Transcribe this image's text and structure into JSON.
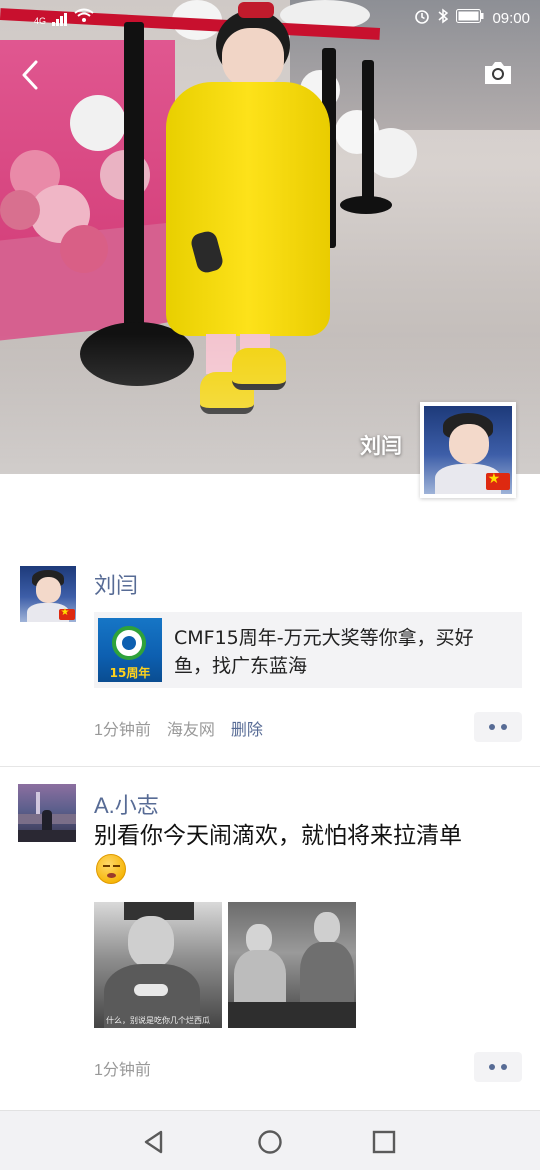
{
  "status_bar": {
    "network": "4G",
    "time": "09:00"
  },
  "cover": {
    "name": "刘闫",
    "back_icon": "chevron-left-icon",
    "camera_icon": "camera-icon"
  },
  "posts": [
    {
      "author": "刘闫",
      "link": {
        "thumb_text": "15周年",
        "title": "CMF15周年-万元大奖等你拿，买好鱼，找广东蓝海"
      },
      "time": "1分钟前",
      "source": "海友网",
      "delete_label": "删除"
    },
    {
      "author": "A.小志",
      "text": "别看你今天闹滴欢，就怕将来拉清单",
      "photo_caption": "什么，别说是吃你几个烂西瓜",
      "time": "1分钟前"
    }
  ],
  "nav": {
    "back_icon": "triangle-back-icon",
    "home_icon": "circle-home-icon",
    "recents_icon": "square-recents-icon"
  },
  "colors": {
    "link_blue": "#576b95",
    "meta_gray": "#999999",
    "card_bg": "#f3f3f5"
  }
}
